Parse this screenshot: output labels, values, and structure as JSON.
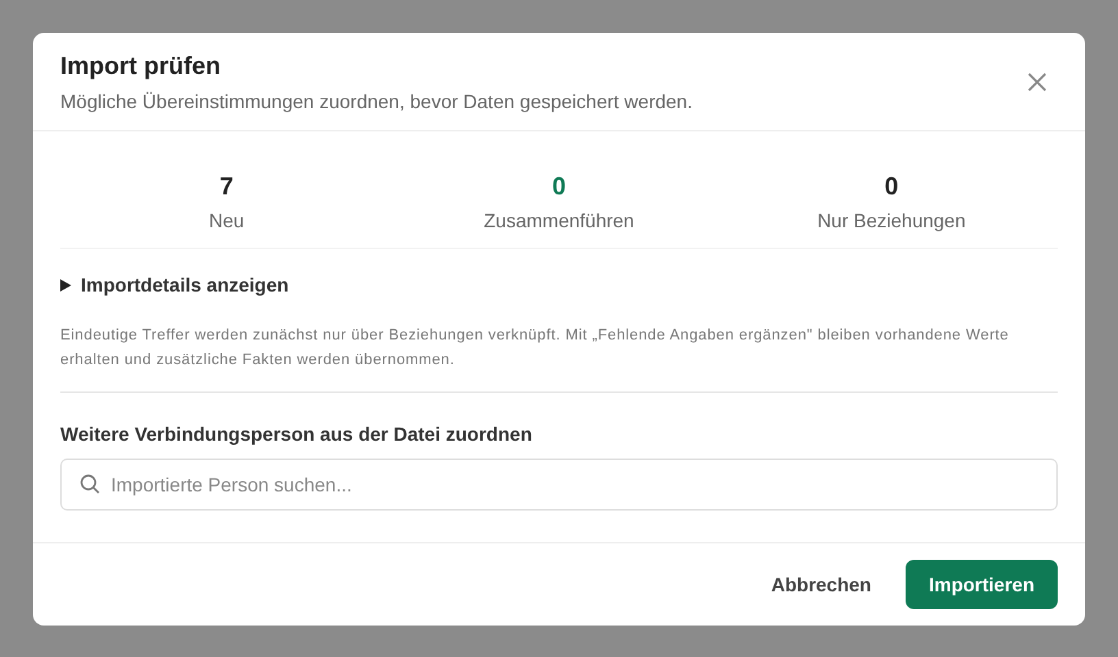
{
  "dialog": {
    "title": "Import prüfen",
    "subtitle": "Mögliche Übereinstimmungen zuordnen, bevor Daten gespeichert werden."
  },
  "stats": [
    {
      "value": "7",
      "label": "Neu",
      "color": "#222222"
    },
    {
      "value": "0",
      "label": "Zusammenführen",
      "color": "#0f7a55"
    },
    {
      "value": "0",
      "label": "Nur Beziehungen",
      "color": "#222222"
    }
  ],
  "details": {
    "label": "Importdetails anzeigen",
    "expanded": false
  },
  "note": "Eindeutige Treffer werden zunächst nur über Beziehungen verknüpft. Mit „Fehlende Angaben ergänzen\" bleiben vorhandene Werte erhalten und zusätzliche Fakten werden übernommen.",
  "assign": {
    "label": "Weitere Verbindungsperson aus der Datei zuordnen",
    "search": {
      "placeholder": "Importierte Person suchen..."
    }
  },
  "buttons": [
    {
      "label": "Abbrechen",
      "kind": "secondary"
    },
    {
      "label": "Importieren",
      "kind": "primary"
    }
  ]
}
